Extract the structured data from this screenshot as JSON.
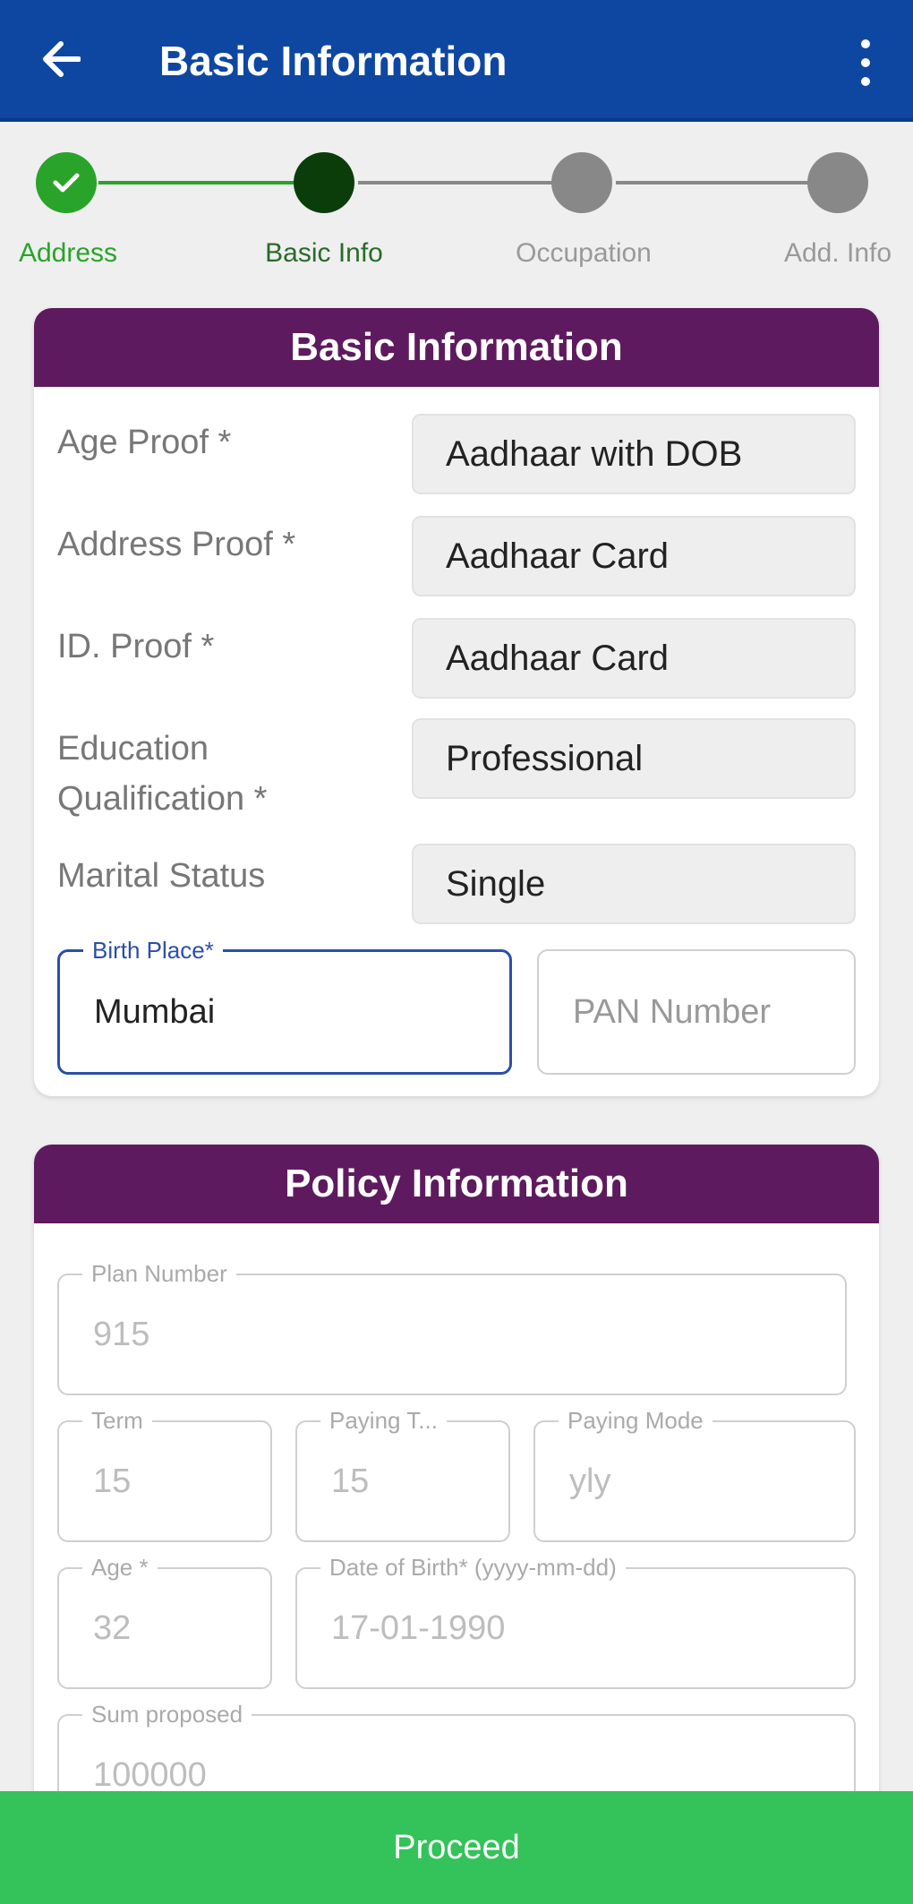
{
  "appbar": {
    "title": "Basic Information",
    "back_icon": "arrow-left-icon",
    "more_icon": "more-vertical-icon",
    "color": "#0d47a1"
  },
  "stepper": {
    "steps": [
      {
        "label": "Address",
        "state": "completed"
      },
      {
        "label": "Basic Info",
        "state": "current"
      },
      {
        "label": "Occupation",
        "state": "pending"
      },
      {
        "label": "Add. Info",
        "state": "pending"
      }
    ],
    "colors": {
      "completed": "#2aa32a",
      "current": "#0b3d0b",
      "pending": "#888888"
    }
  },
  "basic_info": {
    "header": "Basic Information",
    "rows": [
      {
        "label": "Age Proof *",
        "value": "Aadhaar with DOB"
      },
      {
        "label": "Address Proof *",
        "value": "Aadhaar Card"
      },
      {
        "label": "ID. Proof *",
        "value": "Aadhaar Card"
      },
      {
        "label_line1": "Education",
        "label_line2": "Qualification *",
        "value": "Professional"
      },
      {
        "label": "Marital Status",
        "value": "Single"
      }
    ],
    "birth_place": {
      "legend": "Birth Place*",
      "value": "Mumbai"
    },
    "pan": {
      "placeholder": "PAN Number"
    }
  },
  "policy_info": {
    "header": "Policy Information",
    "plan_number": {
      "legend": "Plan Number",
      "value": "915"
    },
    "term": {
      "legend": "Term",
      "value": "15"
    },
    "paying_term": {
      "legend": "Paying T...",
      "value": "15"
    },
    "paying_mode": {
      "legend": "Paying Mode",
      "value": "yly"
    },
    "age": {
      "legend": "Age *",
      "value": "32"
    },
    "dob": {
      "legend": "Date of Birth* (yyyy-mm-dd)",
      "value": "17-01-1990"
    },
    "sum_proposed": {
      "legend": "Sum proposed",
      "value": "100000"
    }
  },
  "footer": {
    "proceed_label": "Proceed",
    "color": "#34c25a"
  },
  "header_color": "#5e1a5f"
}
